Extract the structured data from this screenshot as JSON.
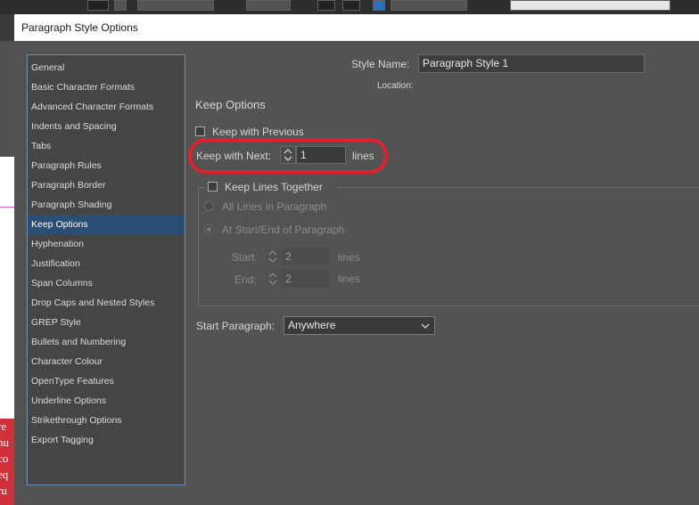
{
  "dialog": {
    "title": "Paragraph Style Options"
  },
  "categories": [
    {
      "label": "General",
      "selected": false
    },
    {
      "label": "Basic Character Formats",
      "selected": false
    },
    {
      "label": "Advanced Character Formats",
      "selected": false
    },
    {
      "label": "Indents and Spacing",
      "selected": false
    },
    {
      "label": "Tabs",
      "selected": false
    },
    {
      "label": "Paragraph Rules",
      "selected": false
    },
    {
      "label": "Paragraph Border",
      "selected": false
    },
    {
      "label": "Paragraph Shading",
      "selected": false
    },
    {
      "label": "Keep Options",
      "selected": true
    },
    {
      "label": "Hyphenation",
      "selected": false
    },
    {
      "label": "Justification",
      "selected": false
    },
    {
      "label": "Span Columns",
      "selected": false
    },
    {
      "label": "Drop Caps and Nested Styles",
      "selected": false
    },
    {
      "label": "GREP Style",
      "selected": false
    },
    {
      "label": "Bullets and Numbering",
      "selected": false
    },
    {
      "label": "Character Colour",
      "selected": false
    },
    {
      "label": "OpenType Features",
      "selected": false
    },
    {
      "label": "Underline Options",
      "selected": false
    },
    {
      "label": "Strikethrough Options",
      "selected": false
    },
    {
      "label": "Export Tagging",
      "selected": false
    }
  ],
  "style_name": {
    "label": "Style Name:",
    "value": "Paragraph Style 1"
  },
  "location": {
    "label": "Location:"
  },
  "section": {
    "heading": "Keep Options"
  },
  "keep_with_previous": {
    "label": "Keep with Previous",
    "checked": false
  },
  "keep_with_next": {
    "label": "Keep with Next:",
    "value": "1",
    "unit": "lines"
  },
  "keep_lines_together": {
    "label": "Keep Lines Together",
    "checked": false,
    "option_all": "All Lines in Paragraph",
    "option_start_end": "At Start/End of Paragraph",
    "start_label": "Start:",
    "start_value": "2",
    "end_label": "End:",
    "end_value": "2",
    "unit": "lines"
  },
  "start_paragraph": {
    "label": "Start Paragraph:",
    "value": "Anywhere"
  },
  "background_doc": {
    "lines": [
      "re",
      "nu",
      "co",
      "eq",
      "ru"
    ]
  },
  "colors": {
    "selection": "#2a4d73",
    "highlight": "#e0202a",
    "panel": "#535353"
  }
}
